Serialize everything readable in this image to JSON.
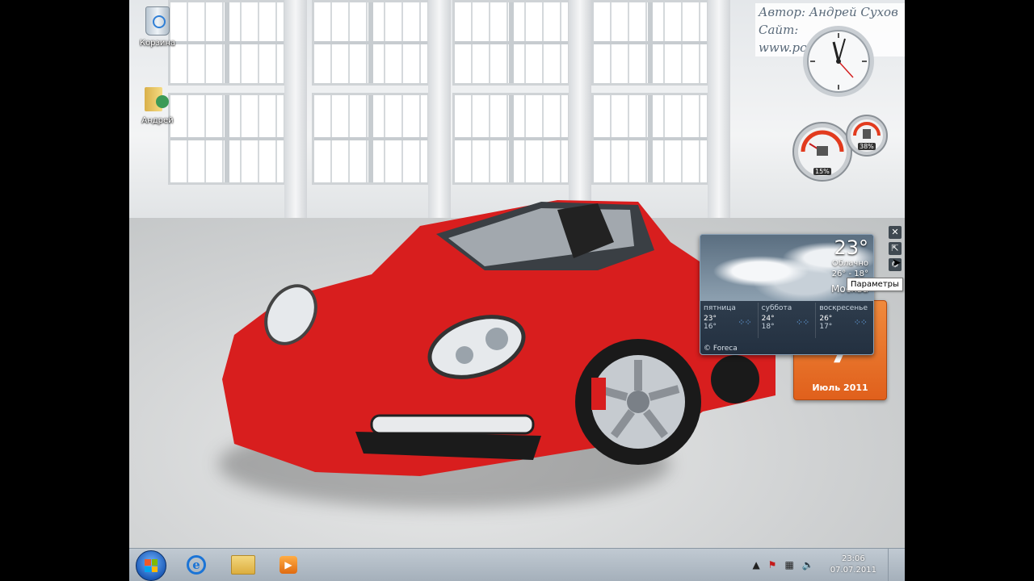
{
  "desktop": {
    "icons": [
      {
        "label": "Корзина"
      },
      {
        "label": "Андрей"
      }
    ],
    "watermark": {
      "line1": "Автор: Андрей Сухов",
      "line2": "Сайт: www.pcsecrets.ru"
    }
  },
  "gadgets": {
    "cpu_meter": {
      "cpu": "15%",
      "memory": "38%"
    },
    "weather": {
      "temperature": "23°",
      "condition": "Облачно",
      "hilo": "26° - 18°",
      "city": "Москва",
      "forecast": [
        {
          "day": "пятница",
          "hi": "23°",
          "lo": "16°"
        },
        {
          "day": "суббота",
          "hi": "24°",
          "lo": "18°"
        },
        {
          "day": "воскресенье",
          "hi": "26°",
          "lo": "17°"
        }
      ],
      "credit": "© Foreca"
    },
    "calendar": {
      "day": "7",
      "month": "Июль 2011"
    },
    "tooltip": "Параметры"
  },
  "taskbar": {
    "time": "23:06",
    "date": "07.07.2011"
  },
  "colors": {
    "accent_orange": "#e0601c",
    "taskbar": "#a0acb8",
    "car_red": "#d81e1e"
  }
}
